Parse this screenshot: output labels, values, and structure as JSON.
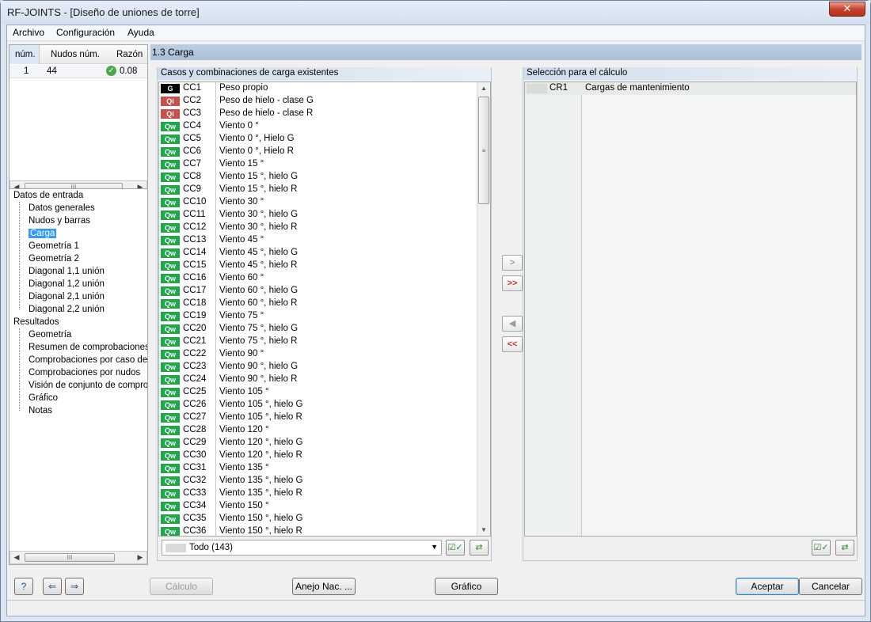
{
  "window": {
    "title": "RF-JOINTS - [Diseño de uniones de torre]",
    "close_label": "✕"
  },
  "menu": [
    "Archivo",
    "Configuración",
    "Ayuda"
  ],
  "left_table": {
    "headers": [
      "núm.",
      "Nudos núm.",
      "Razón"
    ],
    "rows": [
      {
        "num": "1",
        "nodes": "44",
        "ratio": "0.08"
      }
    ]
  },
  "tree": {
    "input_label": "Datos de entrada",
    "input_items": [
      "Datos generales",
      "Nudos y barras",
      "Carga",
      "Geometría 1",
      "Geometría 2",
      "Diagonal 1,1 unión",
      "Diagonal 1,2 unión",
      "Diagonal 2,1 unión",
      "Diagonal 2,2 unión"
    ],
    "results_label": "Resultados",
    "result_items": [
      "Geometría",
      "Resumen de comprobaciones",
      "Comprobaciones por caso de c",
      "Comprobaciones por nudos",
      "Visión de conjunto de comproba",
      "Gráfico",
      "Notas"
    ],
    "selected": "Carga"
  },
  "section_title": "1.3 Carga",
  "existing": {
    "title": "Casos y combinaciones de carga existentes",
    "rows": [
      {
        "badge": "G",
        "code": "CC1",
        "desc": "Peso propio"
      },
      {
        "badge": "Qi",
        "code": "CC2",
        "desc": "Peso de hielo - clase G"
      },
      {
        "badge": "Qi",
        "code": "CC3",
        "desc": "Peso de hielo - clase R"
      },
      {
        "badge": "Qw",
        "code": "CC4",
        "desc": "Viento 0 °"
      },
      {
        "badge": "Qw",
        "code": "CC5",
        "desc": "Viento 0 °, Hielo G"
      },
      {
        "badge": "Qw",
        "code": "CC6",
        "desc": "Viento 0 °, Hielo R"
      },
      {
        "badge": "Qw",
        "code": "CC7",
        "desc": "Viento 15 °"
      },
      {
        "badge": "Qw",
        "code": "CC8",
        "desc": "Viento 15 °, hielo G"
      },
      {
        "badge": "Qw",
        "code": "CC9",
        "desc": "Viento 15 °, hielo R"
      },
      {
        "badge": "Qw",
        "code": "CC10",
        "desc": "Viento 30 °"
      },
      {
        "badge": "Qw",
        "code": "CC11",
        "desc": "Viento 30 °, hielo G"
      },
      {
        "badge": "Qw",
        "code": "CC12",
        "desc": "Viento 30 °, hielo R"
      },
      {
        "badge": "Qw",
        "code": "CC13",
        "desc": "Viento 45 °"
      },
      {
        "badge": "Qw",
        "code": "CC14",
        "desc": "Viento 45 °, hielo G"
      },
      {
        "badge": "Qw",
        "code": "CC15",
        "desc": "Viento 45 °, hielo R"
      },
      {
        "badge": "Qw",
        "code": "CC16",
        "desc": "Viento 60 °"
      },
      {
        "badge": "Qw",
        "code": "CC17",
        "desc": "Viento 60 °, hielo G"
      },
      {
        "badge": "Qw",
        "code": "CC18",
        "desc": "Viento 60 °, hielo R"
      },
      {
        "badge": "Qw",
        "code": "CC19",
        "desc": "Viento 75 °"
      },
      {
        "badge": "Qw",
        "code": "CC20",
        "desc": "Viento 75 °, hielo G"
      },
      {
        "badge": "Qw",
        "code": "CC21",
        "desc": "Viento 75 °, hielo R"
      },
      {
        "badge": "Qw",
        "code": "CC22",
        "desc": "Viento 90 °"
      },
      {
        "badge": "Qw",
        "code": "CC23",
        "desc": "Viento 90 °, hielo G"
      },
      {
        "badge": "Qw",
        "code": "CC24",
        "desc": "Viento 90 °, hielo R"
      },
      {
        "badge": "Qw",
        "code": "CC25",
        "desc": "Viento 105 °"
      },
      {
        "badge": "Qw",
        "code": "CC26",
        "desc": "Viento 105 °, hielo G"
      },
      {
        "badge": "Qw",
        "code": "CC27",
        "desc": "Viento 105 °, hielo R"
      },
      {
        "badge": "Qw",
        "code": "CC28",
        "desc": "Viento 120 °"
      },
      {
        "badge": "Qw",
        "code": "CC29",
        "desc": "Viento 120 °, hielo G"
      },
      {
        "badge": "Qw",
        "code": "CC30",
        "desc": "Viento 120 °, hielo R"
      },
      {
        "badge": "Qw",
        "code": "CC31",
        "desc": "Viento 135 °"
      },
      {
        "badge": "Qw",
        "code": "CC32",
        "desc": "Viento 135 °, hielo G"
      },
      {
        "badge": "Qw",
        "code": "CC33",
        "desc": "Viento 135 °, hielo R"
      },
      {
        "badge": "Qw",
        "code": "CC34",
        "desc": "Viento 150 °"
      },
      {
        "badge": "Qw",
        "code": "CC35",
        "desc": "Viento 150 °, hielo G"
      },
      {
        "badge": "Qw",
        "code": "CC36",
        "desc": "Viento 150 °, hielo R"
      }
    ],
    "filter_value": "Todo (143)"
  },
  "selection": {
    "title": "Selección para el cálculo",
    "rows": [
      {
        "code": "CR1",
        "desc": "Cargas de mantenimiento"
      }
    ]
  },
  "buttons": {
    "calc": "Cálculo",
    "annex": "Anejo Nac. ...",
    "graphic": "Gráfico",
    "accept": "Aceptar",
    "cancel": "Cancelar"
  },
  "colors": {
    "G": "#000000",
    "Qi": "#c8514a",
    "Qw": "#1ea84b",
    "selected": "#3399ff"
  }
}
